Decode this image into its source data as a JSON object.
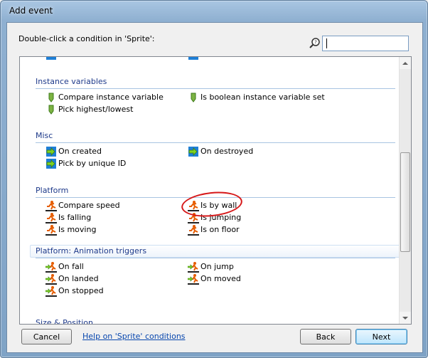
{
  "window": {
    "title": "Add event"
  },
  "header": {
    "prompt": "Double-click a condition in 'Sprite':",
    "search": {
      "value": "",
      "placeholder": ""
    }
  },
  "groups": [
    {
      "title": "Instance variables",
      "items": [
        {
          "label": "Compare instance variable",
          "icon": "instance-variable-icon"
        },
        {
          "label": "Is boolean instance variable set",
          "icon": "instance-variable-icon"
        },
        {
          "label": "Pick highest/lowest",
          "icon": "instance-variable-icon"
        }
      ]
    },
    {
      "title": "Misc",
      "items": [
        {
          "label": "On created",
          "icon": "trigger-icon"
        },
        {
          "label": "On destroyed",
          "icon": "trigger-icon"
        },
        {
          "label": "Pick by unique ID",
          "icon": "trigger-icon"
        }
      ]
    },
    {
      "title": "Platform",
      "items": [
        {
          "label": "Compare speed",
          "icon": "platform-runner-icon"
        },
        {
          "label": "Is by wall",
          "icon": "platform-runner-icon",
          "highlighted": true
        },
        {
          "label": "Is falling",
          "icon": "platform-runner-icon"
        },
        {
          "label": "Is jumping",
          "icon": "platform-runner-icon"
        },
        {
          "label": "Is moving",
          "icon": "platform-runner-icon"
        },
        {
          "label": "Is on floor",
          "icon": "platform-runner-icon"
        }
      ]
    },
    {
      "title": "Platform: Animation triggers",
      "items": [
        {
          "label": "On fall",
          "icon": "platform-trigger-icon"
        },
        {
          "label": "On jump",
          "icon": "platform-trigger-icon"
        },
        {
          "label": "On landed",
          "icon": "platform-trigger-icon"
        },
        {
          "label": "On moved",
          "icon": "platform-trigger-icon"
        },
        {
          "label": "On stopped",
          "icon": "platform-trigger-icon"
        }
      ]
    },
    {
      "title": "Size & Position",
      "items": []
    }
  ],
  "footer": {
    "cancel_label": "Cancel",
    "help_label": "Help on 'Sprite' conditions",
    "back_label": "Back",
    "next_label": "Next"
  },
  "colors": {
    "group_title": "#1e3a8a",
    "highlight_ring": "#d6191a",
    "link": "#0645ad"
  }
}
